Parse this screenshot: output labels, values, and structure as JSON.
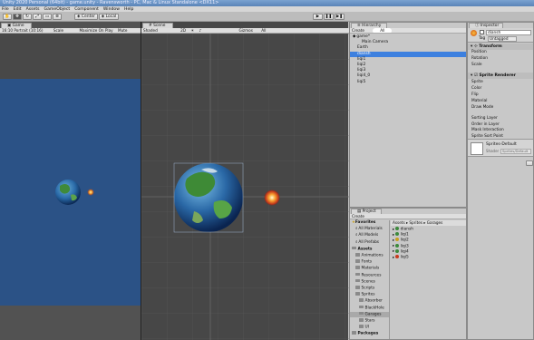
{
  "window": {
    "title": "Unity 2020 Personal (64bit) - game.unity - Ravensworth - PC, Mac & Linux Standalone <DX11>"
  },
  "menu": [
    "File",
    "Edit",
    "Assets",
    "GameObject",
    "Component",
    "Window",
    "Help"
  ],
  "toolbar": {
    "center_label": "Center",
    "local_label": "Local",
    "play_icon": "play-icon",
    "pause_icon": "pause-icon",
    "step_icon": "step-icon"
  },
  "game": {
    "tab": "Game",
    "resolution": "16:10 Portrait (10:16)",
    "scale": "Scale",
    "maximize": "Maximize On Play",
    "mute": "Mute",
    "bg_color": "#2b5286"
  },
  "scene": {
    "tab": "Scene",
    "shading": "Shaded",
    "mode": "2D",
    "gizmos": "Gizmos",
    "search": "All"
  },
  "hierarchy": {
    "tab": "Hierarchy",
    "create": "Create",
    "search": "All",
    "items": [
      {
        "label": "game*",
        "indent": 0,
        "selected": false
      },
      {
        "label": "Main Camera",
        "indent": 2,
        "selected": false
      },
      {
        "label": "Earth",
        "indent": 1,
        "selected": false
      },
      {
        "label": "diansh",
        "indent": 1,
        "selected": true
      },
      {
        "label": "liqi1",
        "indent": 1,
        "selected": false
      },
      {
        "label": "liqi2",
        "indent": 1,
        "selected": false
      },
      {
        "label": "liqi3",
        "indent": 1,
        "selected": false
      },
      {
        "label": "liqi4_0",
        "indent": 1,
        "selected": false
      },
      {
        "label": "liqi5",
        "indent": 1,
        "selected": false
      }
    ]
  },
  "inspector": {
    "tab": "Inspector",
    "name": "diansh",
    "tag_label": "Tag",
    "tag_value": "Untagged",
    "transform": {
      "header": "Transform",
      "fields": [
        "Position",
        "Rotation",
        "Scale"
      ]
    },
    "sprite_renderer": {
      "header": "Sprite Renderer",
      "fields": [
        "Sprite",
        "Color",
        "Flip",
        "Material",
        "Draw Mode",
        "Sorting Layer",
        "Order in Layer",
        "Mask Interaction",
        "Sprite Sort Point"
      ]
    },
    "material": {
      "name": "Sprites-Default",
      "shader_label": "Shader",
      "shader_value": "Sprites/Default"
    }
  },
  "project": {
    "tab": "Project",
    "create": "Create",
    "breadcrumb": "Assets ▸ Sprites ▸ Garages",
    "tree": [
      {
        "label": "Favorites",
        "indent": 0,
        "kind": "fav"
      },
      {
        "label": "All Materials",
        "indent": 1,
        "kind": "search"
      },
      {
        "label": "All Models",
        "indent": 1,
        "kind": "search"
      },
      {
        "label": "All Prefabs",
        "indent": 1,
        "kind": "search"
      },
      {
        "label": "Assets",
        "indent": 0,
        "kind": "folder"
      },
      {
        "label": "Animations",
        "indent": 1,
        "kind": "folder"
      },
      {
        "label": "Fonts",
        "indent": 1,
        "kind": "folder"
      },
      {
        "label": "Materials",
        "indent": 1,
        "kind": "folder"
      },
      {
        "label": "Resources",
        "indent": 1,
        "kind": "folder"
      },
      {
        "label": "Scenes",
        "indent": 1,
        "kind": "folder"
      },
      {
        "label": "Scripts",
        "indent": 1,
        "kind": "folder"
      },
      {
        "label": "Sprites",
        "indent": 1,
        "kind": "folder"
      },
      {
        "label": "Absorber",
        "indent": 2,
        "kind": "folder"
      },
      {
        "label": "BlackHole",
        "indent": 2,
        "kind": "folder"
      },
      {
        "label": "Garages",
        "indent": 2,
        "kind": "folder",
        "selected": true
      },
      {
        "label": "Stars",
        "indent": 2,
        "kind": "folder"
      },
      {
        "label": "UI",
        "indent": 2,
        "kind": "folder"
      },
      {
        "label": "Packages",
        "indent": 0,
        "kind": "folder"
      }
    ],
    "files": [
      {
        "label": "diansh",
        "color": "#3c8a3c"
      },
      {
        "label": "liqi1",
        "color": "#3c8a3c"
      },
      {
        "label": "liqi2",
        "color": "#c8a020"
      },
      {
        "label": "liqi3",
        "color": "#3c8a3c"
      },
      {
        "label": "liqi4",
        "color": "#3c8a3c"
      },
      {
        "label": "liqi5",
        "color": "#c83a1e"
      }
    ]
  }
}
